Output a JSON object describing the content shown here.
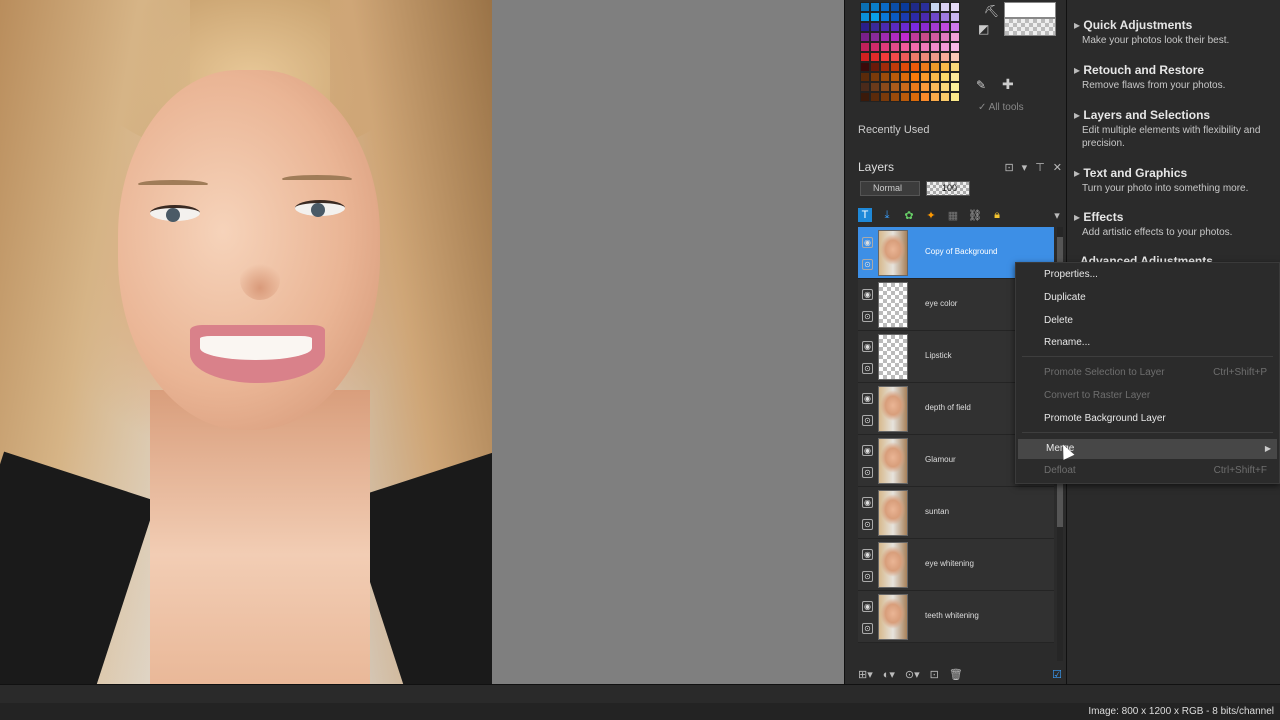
{
  "canvas": {
    "image_alt": "portrait photo"
  },
  "materials": {
    "swatch_colors": [
      "#0b6fb2",
      "#0a7ec9",
      "#0a6ac7",
      "#0b4ea8",
      "#0a3a9a",
      "#1f2a88",
      "#2a2f9a",
      "#c8d6f0",
      "#d9d0f2",
      "#e6dcf8",
      "#0b90d6",
      "#0aa0e6",
      "#0a78d8",
      "#0a5ac0",
      "#1b3bb0",
      "#2d2aa8",
      "#4a2ab0",
      "#6f48c8",
      "#9f7ae0",
      "#c9b6f0",
      "#2a1f8a",
      "#3a2a9a",
      "#4a2ab0",
      "#5a2ac0",
      "#6a2ad0",
      "#7a2ae0",
      "#8a2ad0",
      "#a43ad0",
      "#c04ae0",
      "#d07af0",
      "#7a1f8a",
      "#8a2a9a",
      "#a02ab0",
      "#b02ac0",
      "#c02ad0",
      "#c03a9a",
      "#c84a8a",
      "#d05aa0",
      "#e07ac0",
      "#f0a0d8",
      "#c0205a",
      "#d02a6a",
      "#e03a7a",
      "#e04a8a",
      "#f05a9a",
      "#f06aaa",
      "#f07aba",
      "#f08aca",
      "#f09ad8",
      "#f8b8e8",
      "#d02020",
      "#e02a2a",
      "#f03a3a",
      "#f04a4a",
      "#f05a5a",
      "#f07a6a",
      "#f08a7a",
      "#f09a8a",
      "#f8aa9a",
      "#f8c8b8",
      "#3a0a0a",
      "#6a1a0a",
      "#a02a0a",
      "#c03a0a",
      "#e04a0a",
      "#f05a0a",
      "#f07a1a",
      "#f09a2a",
      "#f8b84a",
      "#f8d87a",
      "#5a2a0a",
      "#7a3a0a",
      "#9a4a0a",
      "#ba5a0a",
      "#da6a0a",
      "#fa7a0a",
      "#fa9a2a",
      "#faba4a",
      "#fad86a",
      "#fae89a",
      "#4a2a1a",
      "#6a3a1a",
      "#8a4a1a",
      "#aa5a1a",
      "#ca6a1a",
      "#ea7a1a",
      "#fa9a3a",
      "#faba5a",
      "#fad87a",
      "#faf09a",
      "#3a1a0a",
      "#5a2a0a",
      "#7a3a0a",
      "#9a4a0a",
      "#ba5a0a",
      "#da6a0a",
      "#fa8a2a",
      "#faaa4a",
      "#faca6a",
      "#fae88a"
    ],
    "all_tools_label": "All tools",
    "recently_used_label": "Recently Used"
  },
  "layers": {
    "title": "Layers",
    "blend_mode": "Normal",
    "opacity": "100",
    "items": [
      {
        "name": "Copy of Background",
        "selected": true,
        "thumb": "photo"
      },
      {
        "name": "eye color",
        "selected": false,
        "thumb": "transparent"
      },
      {
        "name": "Lipstick",
        "selected": false,
        "thumb": "transparent"
      },
      {
        "name": "depth of field",
        "selected": false,
        "thumb": "photo"
      },
      {
        "name": "Glamour",
        "selected": false,
        "thumb": "photo"
      },
      {
        "name": "suntan",
        "selected": false,
        "thumb": "photo"
      },
      {
        "name": "eye whitening",
        "selected": false,
        "thumb": "photo"
      },
      {
        "name": "teeth whitening",
        "selected": false,
        "thumb": "photo"
      }
    ]
  },
  "categories": [
    {
      "title": "Quick Adjustments",
      "desc": "Make your photos look their best."
    },
    {
      "title": "Retouch and Restore",
      "desc": "Remove flaws from your photos."
    },
    {
      "title": "Layers and Selections",
      "desc": "Edit multiple elements with flexibility and precision."
    },
    {
      "title": "Text and Graphics",
      "desc": "Turn your photo into something more."
    },
    {
      "title": "Effects",
      "desc": "Add artistic effects to your photos."
    }
  ],
  "categories_partial": "Advanced Adjustments",
  "context_menu": {
    "items": [
      {
        "label": "Properties...",
        "disabled": false,
        "shortcut": ""
      },
      {
        "label": "Duplicate",
        "disabled": false,
        "shortcut": ""
      },
      {
        "label": "Delete",
        "disabled": false,
        "shortcut": ""
      },
      {
        "label": "Rename...",
        "disabled": false,
        "shortcut": ""
      },
      {
        "label": "Promote Selection to Layer",
        "disabled": true,
        "shortcut": "Ctrl+Shift+P"
      },
      {
        "label": "Convert to Raster Layer",
        "disabled": true,
        "shortcut": ""
      },
      {
        "label": "Promote Background Layer",
        "disabled": false,
        "shortcut": ""
      },
      {
        "label": "Merge",
        "disabled": false,
        "shortcut": "",
        "submenu": true,
        "hover": true
      },
      {
        "label": "Defloat",
        "disabled": true,
        "shortcut": "Ctrl+Shift+F"
      }
    ]
  },
  "status": {
    "image_info": "Image:  800 x 1200 x RGB - 8 bits/channel"
  }
}
